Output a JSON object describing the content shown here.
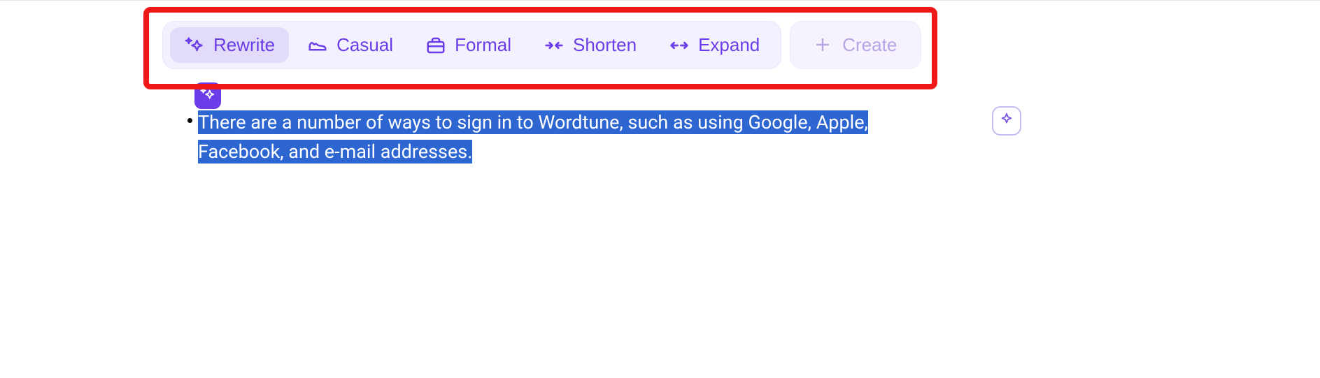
{
  "colors": {
    "accent": "#6a3de8",
    "accent_light": "#b7a4e6",
    "highlight_red": "#ef1717",
    "selection_bg": "#2e66d1",
    "toolbar_bg": "#f4f1fe",
    "active_bg": "#e3dbfa"
  },
  "toolbar": {
    "buttons": [
      {
        "id": "rewrite",
        "label": "Rewrite",
        "icon": "sparkle-icon",
        "active": true
      },
      {
        "id": "casual",
        "label": "Casual",
        "icon": "shoe-icon",
        "active": false
      },
      {
        "id": "formal",
        "label": "Formal",
        "icon": "briefcase-icon",
        "active": false
      },
      {
        "id": "shorten",
        "label": "Shorten",
        "icon": "arrows-in-icon",
        "active": false
      },
      {
        "id": "expand",
        "label": "Expand",
        "icon": "arrows-out-icon",
        "active": false
      }
    ],
    "create": {
      "label": "Create",
      "icon": "plus-icon"
    }
  },
  "badge": {
    "icon": "sparkle-icon"
  },
  "content": {
    "bullet_text": "There are a number of ways to sign in to Wordtune, such as using Google, Apple, Facebook, and e-mail addresses."
  },
  "floating": {
    "icon": "sparkle-outline-icon"
  }
}
